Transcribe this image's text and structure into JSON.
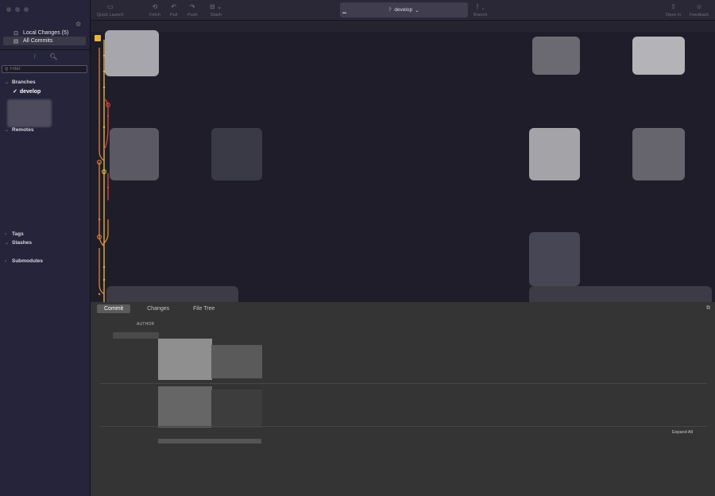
{
  "sidebar": {
    "top_items": [
      {
        "label": "Local Changes (5)",
        "icon": "local-changes-icon",
        "glyph": "⊡"
      },
      {
        "label": "All Commits",
        "icon": "commits-icon",
        "glyph": "▤"
      }
    ],
    "tab_icons": [
      "branch-icon",
      "search-icon"
    ],
    "filter_placeholder": "Filter",
    "sections": {
      "branches": "Branches",
      "remotes": "Remotes",
      "tags": "Tags",
      "stashes": "Stashes",
      "submodules": "Submodules"
    },
    "current_branch": "develop"
  },
  "toolbar": {
    "quick_launch": "Quick Launch",
    "fetch": "Fetch",
    "pull": "Pull",
    "push": "Push",
    "stash": "Stash",
    "branch_selector": "develop",
    "branch": "Branch",
    "open_in": "Open in",
    "feedback": "Feedback"
  },
  "bottom": {
    "tabs": [
      "Commit",
      "Changes",
      "File Tree"
    ],
    "author_label": "AUTHOR",
    "expand_all": "Expand All"
  },
  "colors": {
    "accent": "#3d7bd8",
    "graph_yellow": "#e8c13a",
    "graph_orange": "#e0823a",
    "graph_red": "#d9443b"
  }
}
